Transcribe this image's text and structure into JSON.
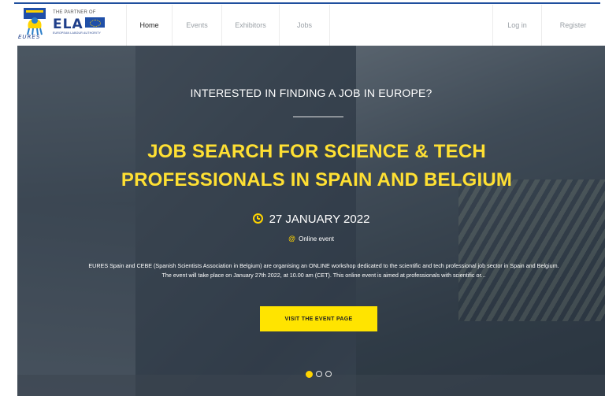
{
  "brand": {
    "eures_text": "EURES",
    "partner_text": "THE PARTNER OF",
    "ela_text": "ELA",
    "ela_sub": "EUROPEAN LABOUR AUTHORITY"
  },
  "nav": {
    "home": "Home",
    "events": "Events",
    "exhibitors": "Exhibitors",
    "jobs": "Jobs",
    "login": "Log in",
    "register": "Register"
  },
  "hero": {
    "kicker": "INTERESTED IN FINDING A JOB IN EUROPE?",
    "title_line1": "JOB SEARCH FOR SCIENCE & TECH",
    "title_line2": "PROFESSIONALS IN SPAIN AND BELGIUM",
    "date": "27 JANUARY 2022",
    "venue": "Online event",
    "description": "EURES Spain and CEBE (Spanish Scientists Association in Belgium) are organising an ONLINE workshop dedicated to the scientific and tech professional job sector in Spain and Belgium. The event will take place on January 27th 2022, at 10.00 am (CET). This online event is aimed at professionals with scientific or...",
    "cta": "VISIT THE EVENT PAGE"
  },
  "carousel": {
    "slide_count": 3,
    "active_index": 0
  },
  "colors": {
    "accent": "#ffe400",
    "nav_active": "#222222",
    "nav_inactive": "#9aa0a6",
    "brand_blue": "#1f3f8a"
  },
  "icons": [
    "clock-icon",
    "at-icon",
    "eures-logo-icon",
    "ela-logo-icon"
  ]
}
